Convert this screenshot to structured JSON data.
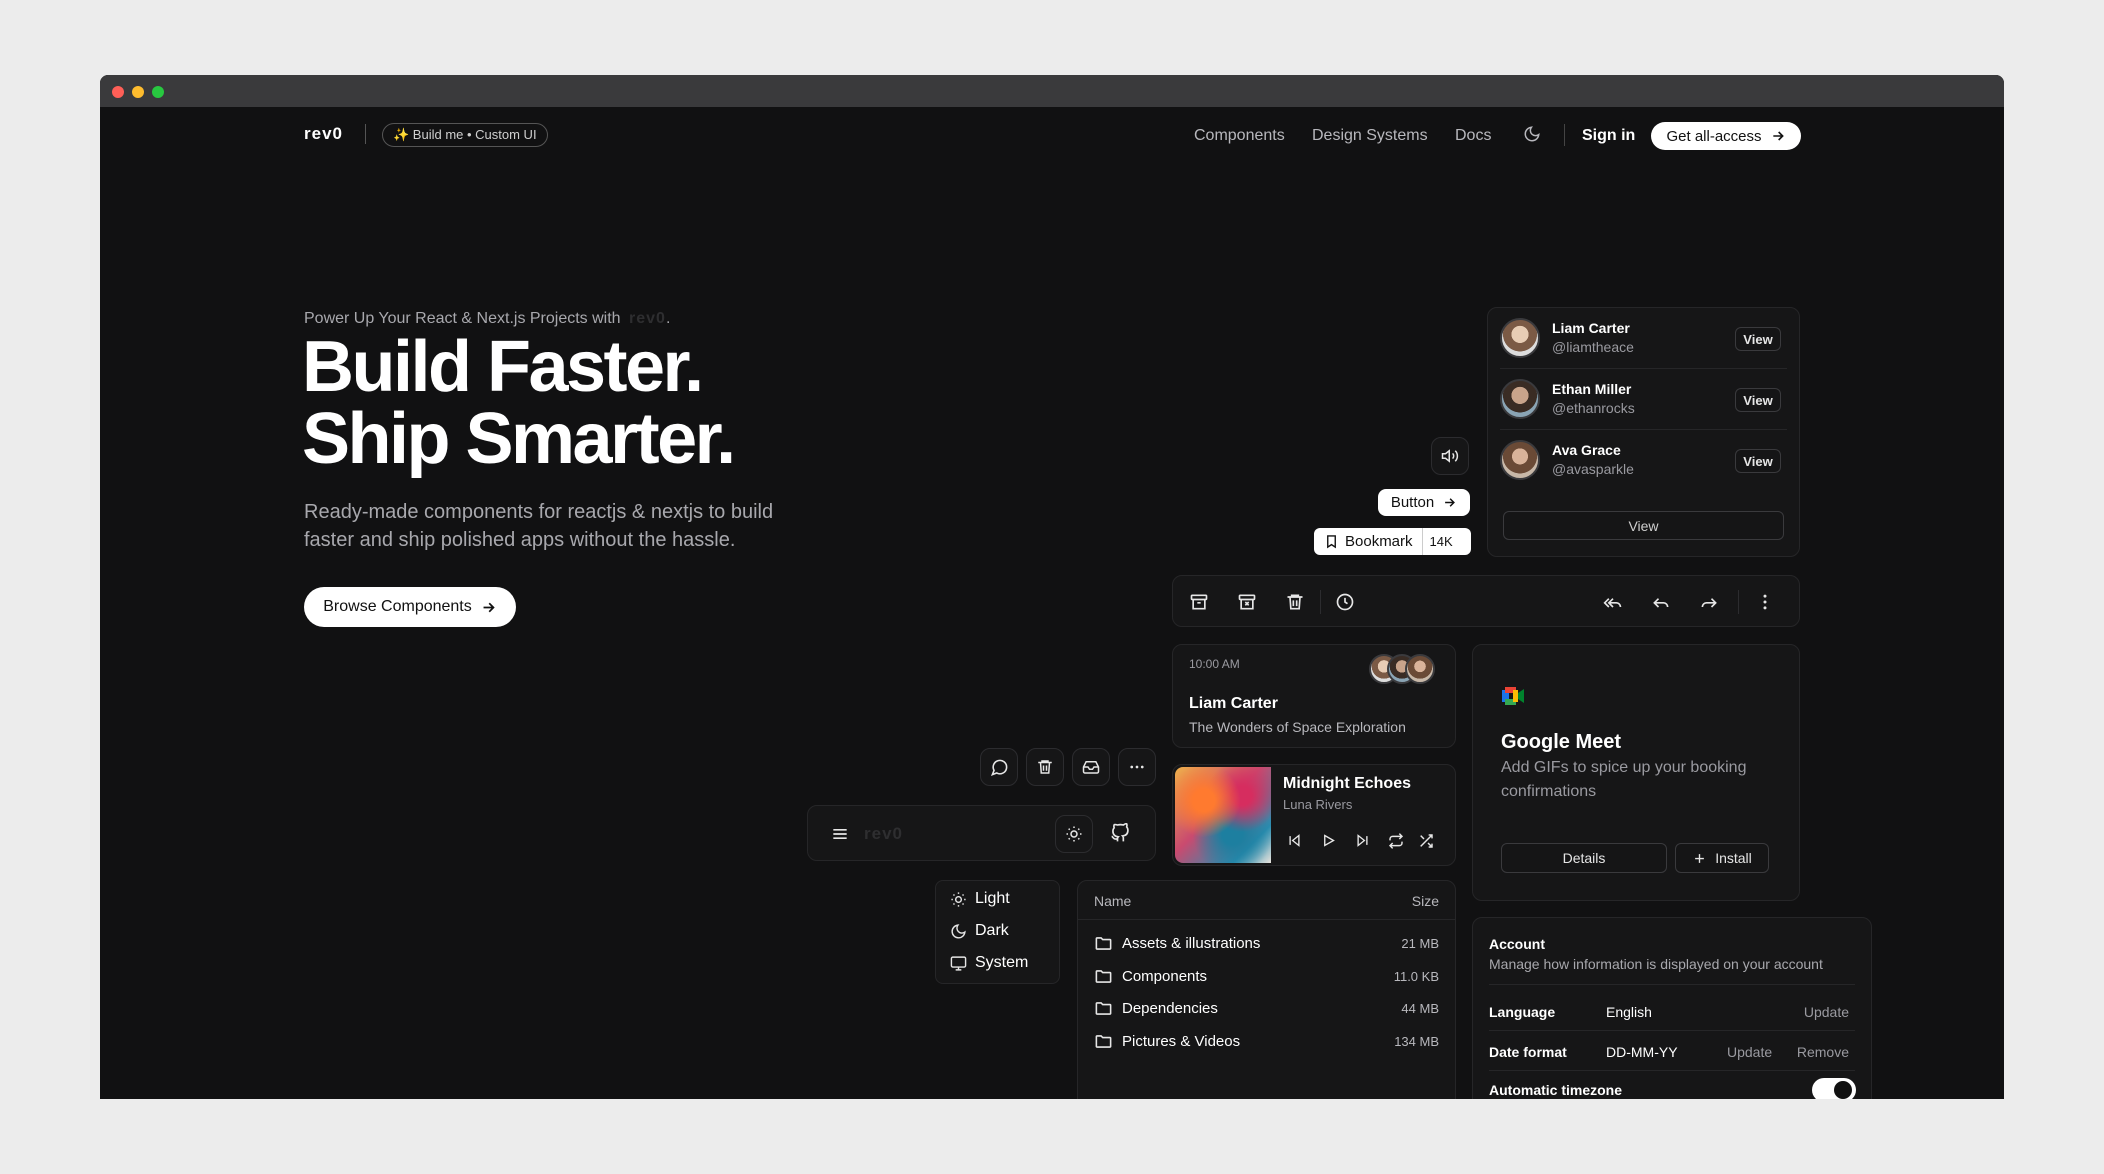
{
  "nav": {
    "logo": "rev0",
    "badge": "✨ Build me • Custom UI",
    "links": [
      "Components",
      "Design Systems",
      "Docs"
    ],
    "signin": "Sign in",
    "cta": "Get all-access"
  },
  "hero": {
    "eyebrow": "Power Up Your React & Next.js Projects with",
    "eyebrow_logo": "rev0",
    "title_line1": "Build Faster.",
    "title_line2": "Ship Smarter.",
    "subtitle_line1": "Ready-made components for reactjs & nextjs to build",
    "subtitle_line2": "faster and ship polished apps without the hassle.",
    "cta": "Browse Components"
  },
  "users": {
    "items": [
      {
        "name": "Liam Carter",
        "handle": "@liamtheace",
        "action": "View"
      },
      {
        "name": "Ethan Miller",
        "handle": "@ethanrocks",
        "action": "View"
      },
      {
        "name": "Ava Grace",
        "handle": "@avasparkle",
        "action": "View"
      }
    ],
    "footer_button": "View"
  },
  "demo_buttons": {
    "button_label": "Button",
    "bookmark_label": "Bookmark",
    "bookmark_count": "14K"
  },
  "email": {
    "time": "10:00 AM",
    "sender": "Liam Carter",
    "subject": "The Wonders of Space Exploration"
  },
  "meet": {
    "title": "Google Meet",
    "desc_line1": "Add GIFs to spice up your booking",
    "desc_line2": "confirmations",
    "details": "Details",
    "install": "Install"
  },
  "player": {
    "track": "Midnight Echoes",
    "artist": "Luna Rivers"
  },
  "mininav": {
    "logo": "rev0"
  },
  "theme_menu": [
    "Light",
    "Dark",
    "System"
  ],
  "files": {
    "headers": [
      "Name",
      "Size"
    ],
    "rows": [
      {
        "name": "Assets & illustrations",
        "size": "21 MB"
      },
      {
        "name": "Components",
        "size": "11.0 KB"
      },
      {
        "name": "Dependencies",
        "size": "44 MB"
      },
      {
        "name": "Pictures & Videos",
        "size": "134 MB"
      }
    ]
  },
  "account": {
    "title": "Account",
    "desc": "Manage how information is displayed on your account",
    "language_label": "Language",
    "language_value": "English",
    "language_action": "Update",
    "date_label": "Date format",
    "date_value": "DD-MM-YY",
    "date_update": "Update",
    "date_remove": "Remove",
    "timezone_label": "Automatic timezone"
  },
  "colors": {
    "bg": "#111112",
    "card": "#161617",
    "accent": "#ffffff",
    "mac_red": "#ff5f57",
    "mac_yellow": "#febc2e",
    "mac_green": "#28c840"
  }
}
